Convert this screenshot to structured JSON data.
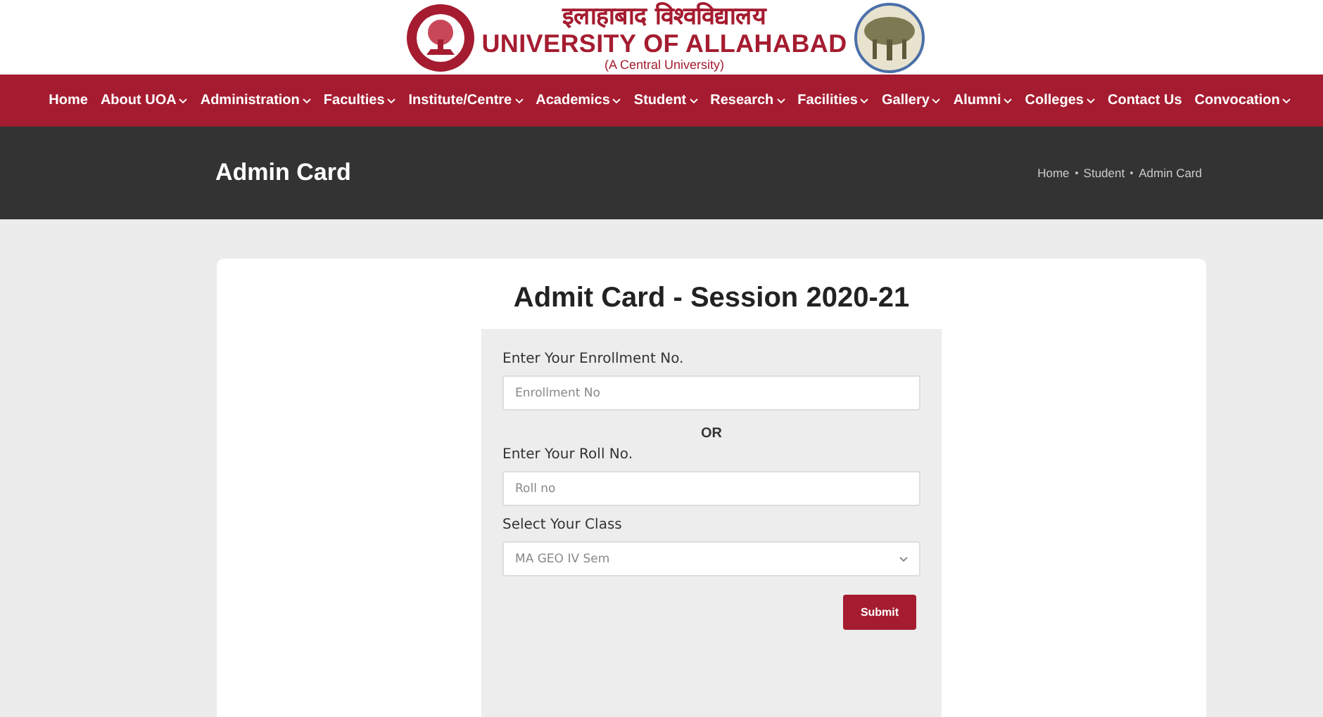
{
  "header": {
    "hindi_name": "इलाहाबाद विश्वविद्यालय",
    "name": "UNIVERSITY OF ALLAHABAD",
    "subtitle": "(A Central University)"
  },
  "nav": [
    {
      "label": "Home",
      "dropdown": false
    },
    {
      "label": "About UOA",
      "dropdown": true
    },
    {
      "label": "Administration",
      "dropdown": true
    },
    {
      "label": "Faculties",
      "dropdown": true
    },
    {
      "label": "Institute/Centre",
      "dropdown": true
    },
    {
      "label": "Academics",
      "dropdown": true
    },
    {
      "label": "Student",
      "dropdown": true
    },
    {
      "label": "Research",
      "dropdown": true
    },
    {
      "label": "Facilities",
      "dropdown": true
    },
    {
      "label": "Gallery",
      "dropdown": true
    },
    {
      "label": "Alumni",
      "dropdown": true
    },
    {
      "label": "Colleges",
      "dropdown": true
    },
    {
      "label": "Contact Us",
      "dropdown": false
    },
    {
      "label": "Convocation",
      "dropdown": true
    }
  ],
  "banner": {
    "title": "Admin Card",
    "breadcrumb": [
      "Home",
      "Student",
      "Admin Card"
    ]
  },
  "form": {
    "title": "Admit Card - Session 2020-21",
    "enrollment": {
      "label": "Enter Your Enrollment No.",
      "placeholder": "Enrollment No"
    },
    "separator": "OR",
    "roll": {
      "label": "Enter Your Roll No.",
      "placeholder": "Roll no"
    },
    "class": {
      "label": "Select Your Class",
      "value": "MA GEO IV Sem"
    },
    "submit": "Submit"
  }
}
